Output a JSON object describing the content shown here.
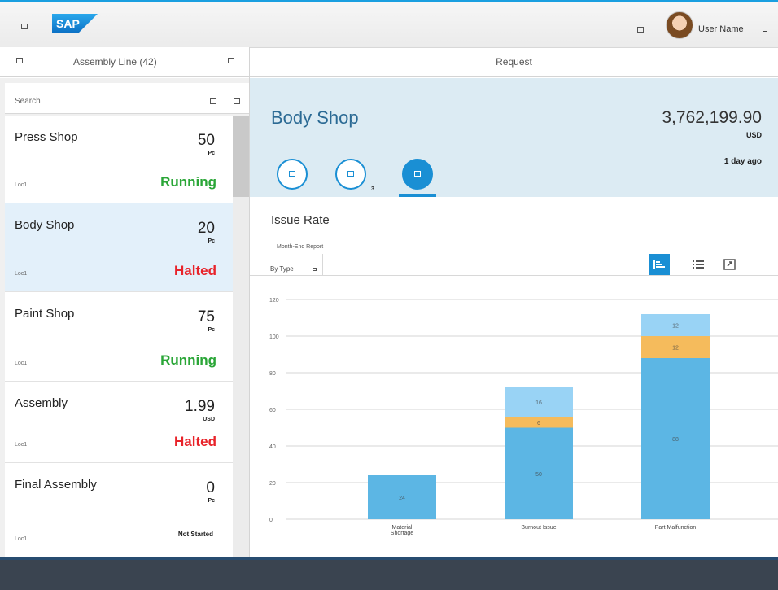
{
  "shell": {
    "logo_text": "SAP",
    "user_name": "User Name"
  },
  "master": {
    "title": "Assembly  Line (42)",
    "search_placeholder": "Search",
    "items": [
      {
        "name": "Press Shop",
        "number": "50",
        "unit": "Pc",
        "location": "Loc1",
        "status": "Running",
        "status_color": "#2aa637"
      },
      {
        "name": "Body Shop",
        "number": "20",
        "unit": "Pc",
        "location": "Loc1",
        "status": "Halted",
        "status_color": "#e8232a"
      },
      {
        "name": "Paint Shop",
        "number": "75",
        "unit": "Pc",
        "location": "Loc1",
        "status": "Running",
        "status_color": "#2aa637"
      },
      {
        "name": "Assembly",
        "number": "1.99",
        "unit": "USD",
        "location": "Loc1",
        "status": "Halted",
        "status_color": "#e8232a"
      },
      {
        "name": "Final Assembly",
        "number": "0",
        "unit": "Pc",
        "location": "Loc1",
        "status": "Not Started",
        "status_color": "#222222"
      }
    ],
    "selected_index": 1
  },
  "detail": {
    "header_title": "Request",
    "object_title": "Body Shop",
    "amount": "3,762,199.90",
    "currency": "USD",
    "date": "1 day ago",
    "tabs": [
      {
        "icon": "info-icon",
        "count": ""
      },
      {
        "icon": "attachment-icon",
        "count": "3"
      },
      {
        "icon": "bar-chart-icon",
        "count": ""
      }
    ],
    "active_tab": 2,
    "chart_title": "Issue Rate",
    "subtitle": "Month-End  Report",
    "filter_label": "By Type"
  },
  "colors": {
    "accent": "#1a9fe0",
    "selected_row": "#e3f0fa",
    "header_bg": "#dcebf3",
    "bar_blue": "#5cb6e4",
    "bar_orange": "#f5bb5c",
    "bar_light": "#99d3f5"
  },
  "chart_data": {
    "type": "bar",
    "stacked": true,
    "categories": [
      "Material\nShortage",
      "Burnout Issue",
      "Part Malfunction"
    ],
    "series": [
      {
        "values": [
          24,
          50,
          88
        ],
        "color": "#5cb6e4"
      },
      {
        "values": [
          0,
          6,
          12
        ],
        "color": "#f5bb5c"
      },
      {
        "values": [
          0,
          16,
          12
        ],
        "color": "#99d3f5"
      }
    ],
    "ylim": [
      0,
      120
    ],
    "yticks": [
      0,
      20,
      40,
      60,
      80,
      100,
      120
    ],
    "grid": true,
    "xlabel": "",
    "ylabel": ""
  }
}
